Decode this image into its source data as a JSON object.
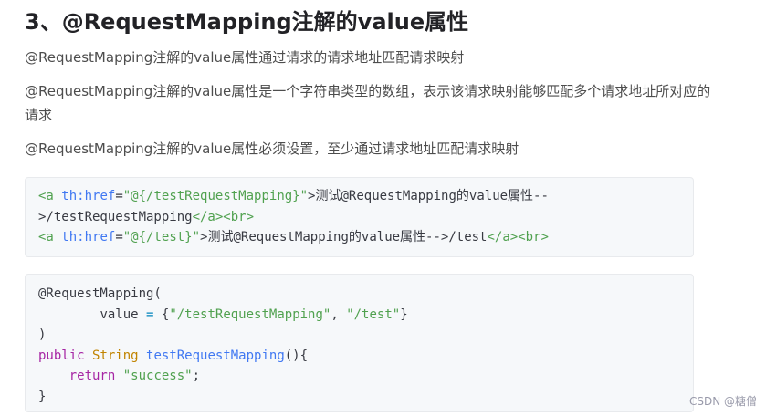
{
  "heading": "3、@RequestMapping注解的value属性",
  "paragraphs": [
    "@RequestMapping注解的value属性通过请求的请求地址匹配请求映射",
    "@RequestMapping注解的value属性是一个字符串类型的数组，表示该请求映射能够匹配多个请求地址所对应的请求",
    "@RequestMapping注解的value属性必须设置，至少通过请求地址匹配请求映射"
  ],
  "code_block_1": {
    "line1": {
      "tag_open": "<a",
      "attr": "th:href",
      "eq": "=",
      "value": "\"@{/testRequestMapping}\"",
      "text": ">测试@RequestMapping的value属性--"
    },
    "line2": {
      "text": ">/testRequestMapping",
      "close_a": "</a>",
      "br": "<br>"
    },
    "line3": {
      "tag_open": "<a",
      "attr": "th:href",
      "eq": "=",
      "value": "\"@{/test}\"",
      "text": ">测试@RequestMapping的value属性-->/test",
      "close_a": "</a>",
      "br": "<br>"
    }
  },
  "code_block_2": {
    "annotation": "@RequestMapping(",
    "value_key": "value",
    "eq": " = ",
    "brace_open": "{",
    "val1": "\"/testRequestMapping\"",
    "comma": ", ",
    "val2": "\"/test\"",
    "brace_close": "}",
    "paren_close": ")",
    "kw_public": "public",
    "type_string": "String",
    "method_name": "testRequestMapping",
    "method_tail": "(){",
    "kw_return": "return",
    "return_value": "\"success\"",
    "semicolon": ";",
    "closing_brace": "}"
  },
  "watermark": "CSDN @糖僧"
}
